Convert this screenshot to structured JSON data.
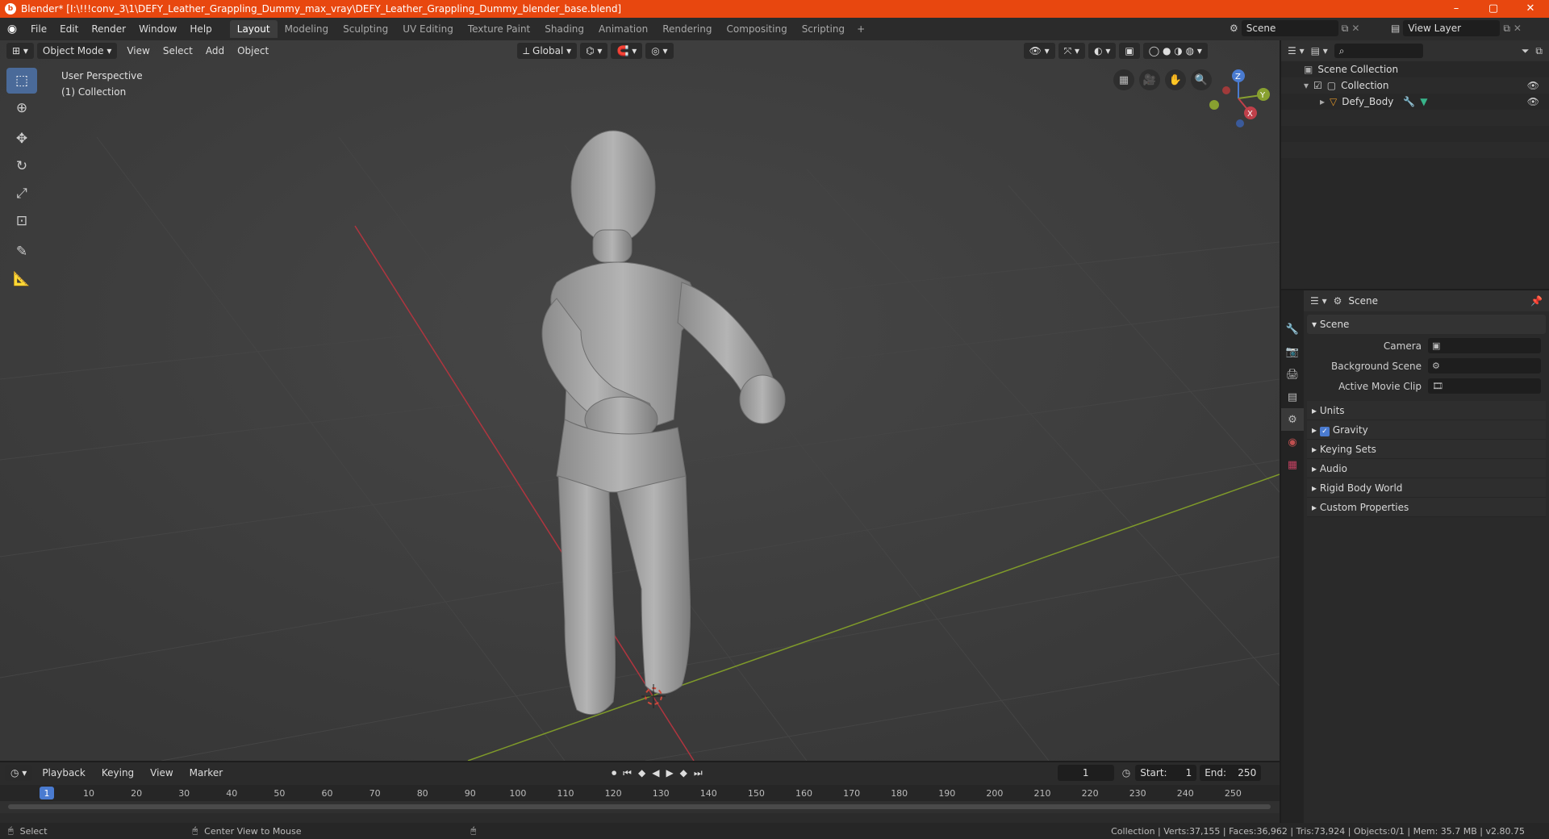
{
  "window": {
    "title": "Blender* [I:\\!!!conv_3\\1\\DEFY_Leather_Grappling_Dummy_max_vray\\DEFY_Leather_Grappling_Dummy_blender_base.blend]",
    "min": "–",
    "max": "▢",
    "close": "✕"
  },
  "menu": [
    "File",
    "Edit",
    "Render",
    "Window",
    "Help"
  ],
  "workspaces": [
    "Layout",
    "Modeling",
    "Sculpting",
    "UV Editing",
    "Texture Paint",
    "Shading",
    "Animation",
    "Rendering",
    "Compositing",
    "Scripting"
  ],
  "active_workspace": "Layout",
  "scene_field": "Scene",
  "view_layer_field": "View Layer",
  "viewport": {
    "mode": "Object Mode",
    "menus": [
      "View",
      "Select",
      "Add",
      "Object"
    ],
    "orientation": "Global",
    "info_line1": "User Perspective",
    "info_line2": "(1) Collection"
  },
  "gizmo": {
    "x": "X",
    "y": "Y",
    "z": "Z"
  },
  "outliner": {
    "root": "Scene Collection",
    "collection": "Collection",
    "object": "Defy_Body"
  },
  "properties": {
    "header": "Scene",
    "panel": "Scene",
    "camera_label": "Camera",
    "background_label": "Background Scene",
    "clip_label": "Active Movie Clip",
    "subpanels": [
      "Units",
      "Gravity",
      "Keying Sets",
      "Audio",
      "Rigid Body World",
      "Custom Properties"
    ]
  },
  "timeline": {
    "menus": [
      "Playback",
      "Keying",
      "View",
      "Marker"
    ],
    "current_frame": "1",
    "start_label": "Start:",
    "start": "1",
    "end_label": "End:",
    "end": "250",
    "ticks": [
      "1",
      "10",
      "20",
      "30",
      "40",
      "50",
      "60",
      "70",
      "80",
      "90",
      "100",
      "110",
      "120",
      "130",
      "140",
      "150",
      "160",
      "170",
      "180",
      "190",
      "200",
      "210",
      "220",
      "230",
      "240",
      "250"
    ]
  },
  "status": {
    "left": "Select",
    "middle": "Center View to Mouse",
    "stats": "Collection | Verts:37,155 | Faces:36,962 | Tris:73,924 | Objects:0/1 | Mem: 35.7 MB | v2.80.75"
  },
  "colors": {
    "accent": "#4a7bd0",
    "titlebar": "#e8470f",
    "x_axis": "#c0404a",
    "y_axis": "#88a030"
  }
}
